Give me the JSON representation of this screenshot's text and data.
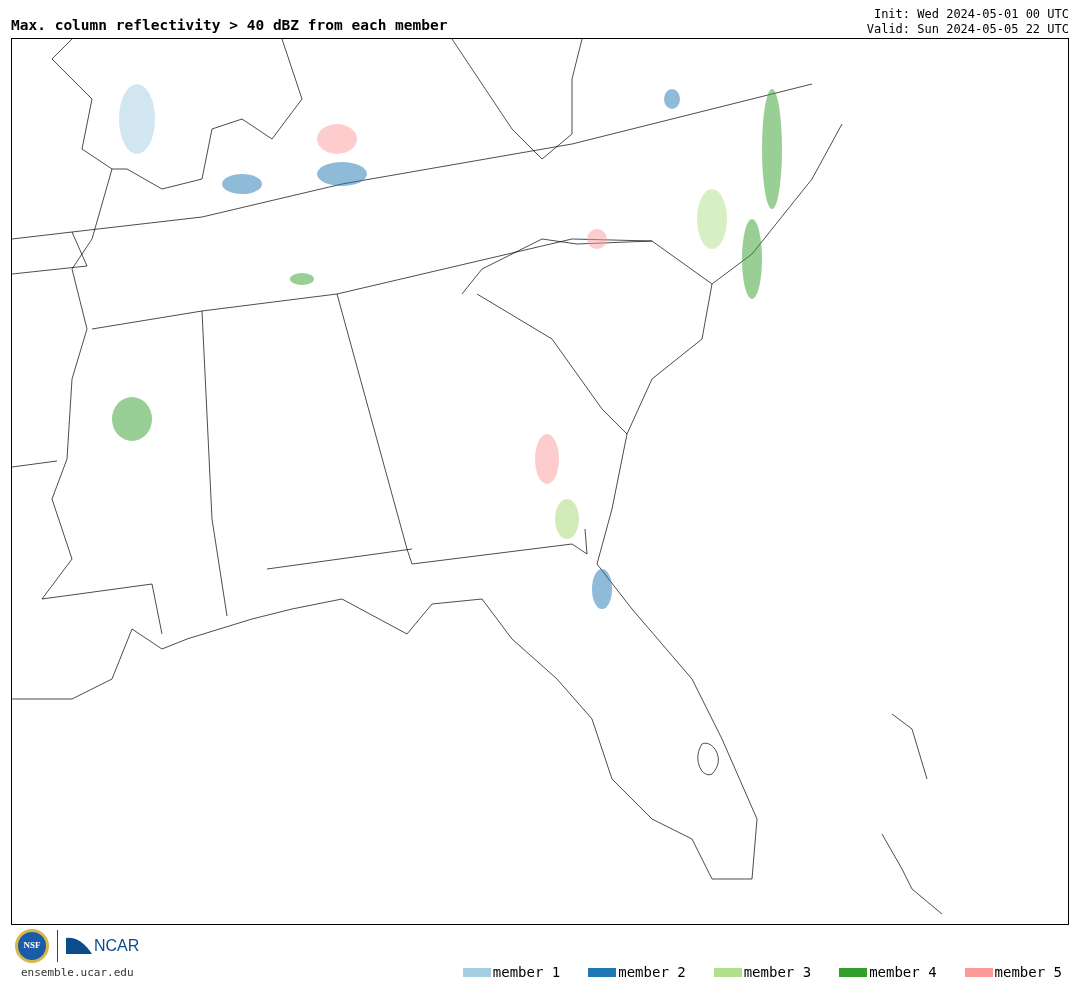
{
  "title": "Max. column reflectivity > 40 dBZ from each member",
  "init": "Init: Wed 2024-05-01 00 UTC",
  "valid": "Valid: Sun 2024-05-05 22 UTC",
  "logos": {
    "nsf": "NSF",
    "ncar": "NCAR"
  },
  "site": "ensemble.ucar.edu",
  "legend": [
    {
      "label": "member 1",
      "color": "#a6cee3"
    },
    {
      "label": "member 2",
      "color": "#1f78b4"
    },
    {
      "label": "member 3",
      "color": "#b2df8a"
    },
    {
      "label": "member 4",
      "color": "#33a02c"
    },
    {
      "label": "member 5",
      "color": "#fb9a99"
    }
  ]
}
